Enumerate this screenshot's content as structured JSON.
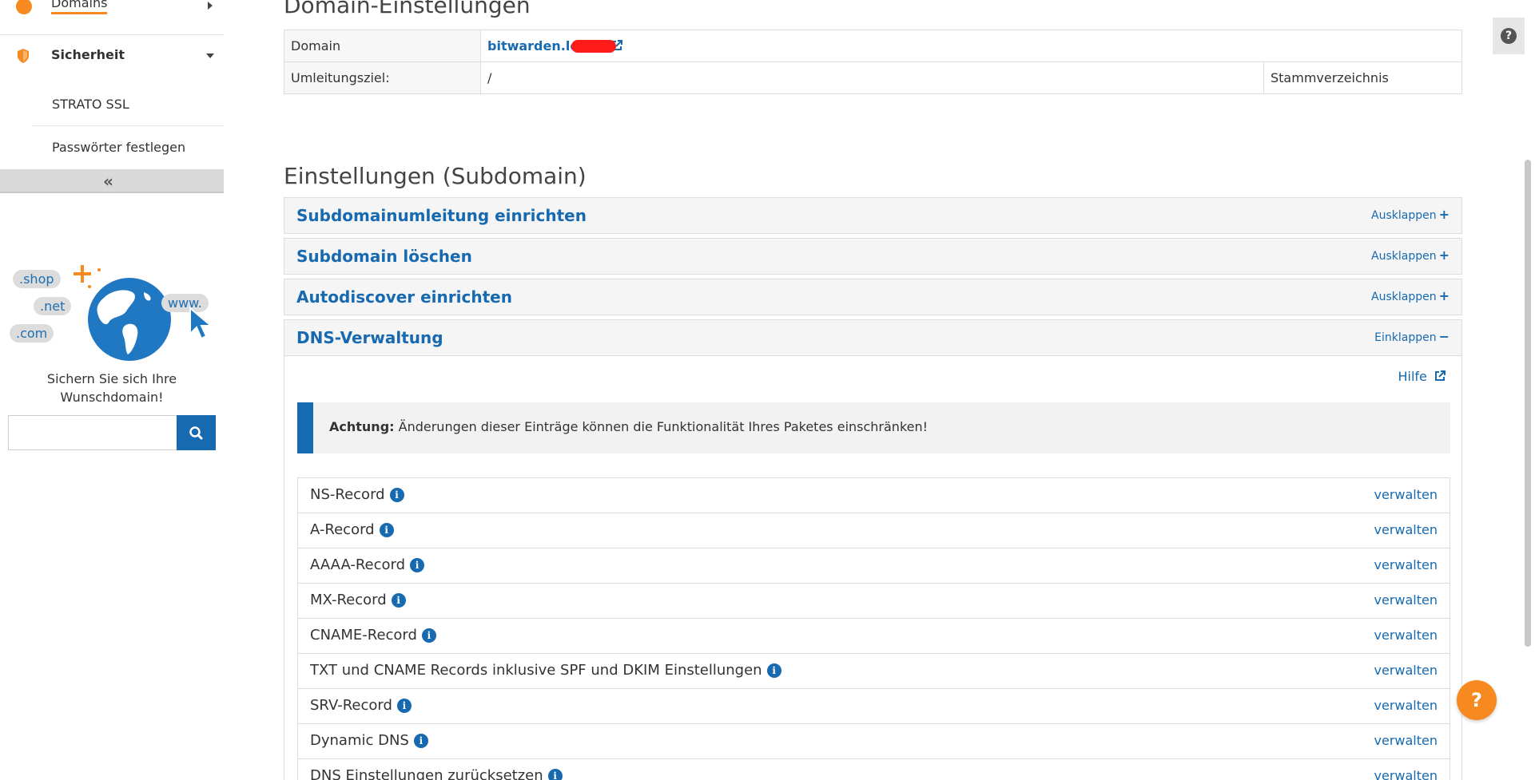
{
  "sidebar": {
    "nav_domains": "Domains",
    "nav_sicherheit": "Sicherheit",
    "sub_items": [
      "STRATO SSL",
      "Passwörter festlegen"
    ],
    "collapse_symbol": "«",
    "promo": {
      "bubbles": [
        ".shop",
        ".net",
        ".com",
        "www."
      ],
      "text": "Sichern Sie sich Ihre Wunschdomain!",
      "search_placeholder": ""
    }
  },
  "main": {
    "heading": "Domain-Einstellungen",
    "domain_table": {
      "row1": {
        "key": "Domain",
        "value": "bitwarden.le de"
      },
      "row2": {
        "key": "Umleitungsziel:",
        "value": "/",
        "extra": "Stammverzeichnis"
      }
    },
    "subdomain_heading": "Einstellungen (Subdomain)",
    "accordions": [
      {
        "title": "Subdomainumleitung einrichten",
        "toggle": "Ausklappen",
        "sign": "+"
      },
      {
        "title": "Subdomain löschen",
        "toggle": "Ausklappen",
        "sign": "+"
      },
      {
        "title": "Autodiscover einrichten",
        "toggle": "Ausklappen",
        "sign": "+"
      },
      {
        "title": "DNS-Verwaltung",
        "toggle": "Einklappen",
        "sign": "−"
      }
    ],
    "dns": {
      "help_link": "Hilfe",
      "alert_bold": "Achtung:",
      "alert_text": " Änderungen dieser Einträge können die Funktionalität Ihres Paketes einschränken!",
      "records": [
        {
          "name": "NS-Record",
          "action": "verwalten"
        },
        {
          "name": "A-Record",
          "action": "verwalten"
        },
        {
          "name": "AAAA-Record",
          "action": "verwalten"
        },
        {
          "name": "MX-Record",
          "action": "verwalten"
        },
        {
          "name": "CNAME-Record",
          "action": "verwalten"
        },
        {
          "name": "TXT und CNAME Records inklusive SPF und DKIM Einstellungen",
          "action": "verwalten"
        },
        {
          "name": "SRV-Record",
          "action": "verwalten"
        },
        {
          "name": "Dynamic DNS",
          "action": "verwalten"
        },
        {
          "name": "DNS Einstellungen zurücksetzen",
          "action": "verwalten"
        }
      ]
    }
  },
  "help": {
    "tab_symbol": "?",
    "float_symbol": "?"
  },
  "colors": {
    "accent_blue": "#1769b0",
    "accent_orange": "#f68a21"
  }
}
